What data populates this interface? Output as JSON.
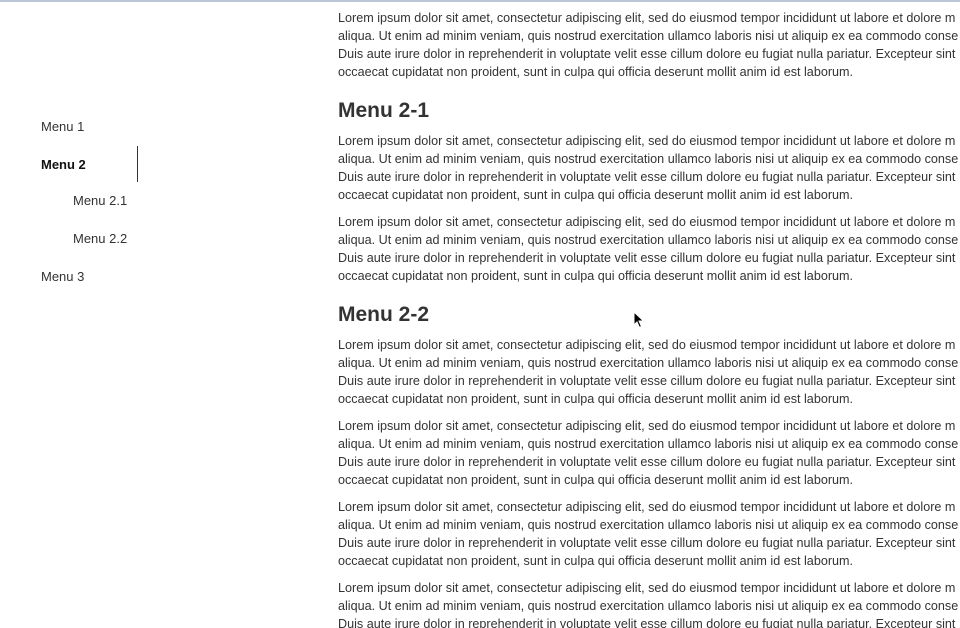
{
  "sidebar": {
    "items": [
      {
        "label": "Menu 1"
      },
      {
        "label": "Menu 2",
        "active": true
      },
      {
        "label": "Menu 2.1"
      },
      {
        "label": "Menu 2.2"
      },
      {
        "label": "Menu 3"
      }
    ]
  },
  "content": {
    "lorem_lines": [
      "Lorem ipsum dolor sit amet, consectetur adipiscing elit, sed do eiusmod tempor incididunt ut labore et dolore m",
      "aliqua. Ut enim ad minim veniam, quis nostrud exercitation ullamco laboris nisi ut aliquip ex ea commodo conse",
      "Duis aute irure dolor in reprehenderit in voluptate velit esse cillum dolore eu fugiat nulla pariatur. Excepteur sint",
      "occaecat cupidatat non proident, sunt in culpa qui officia deserunt mollit anim id est laborum."
    ],
    "headings": {
      "menu_2_1": "Menu 2-1",
      "menu_2_2": "Menu 2-2"
    }
  },
  "colors": {
    "text": "#333333",
    "top_border": "#b8c6d6"
  },
  "icons": {
    "cursor": "mouse-pointer-icon"
  }
}
